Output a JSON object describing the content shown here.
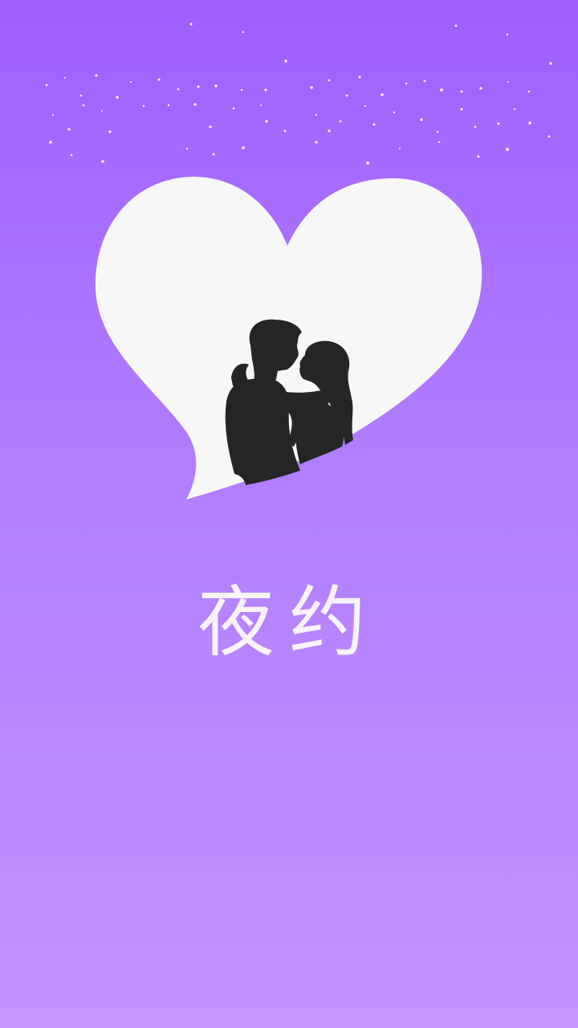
{
  "app": {
    "title": "夜约"
  },
  "icons": {
    "hero": "heart-couple-silhouette-icon"
  },
  "colors": {
    "background_top": "#a15eff",
    "background_bottom": "#c494ff",
    "heart_fill": "#f7f7f7",
    "silhouette": "#252525",
    "title_text": "#f7f3fb"
  }
}
